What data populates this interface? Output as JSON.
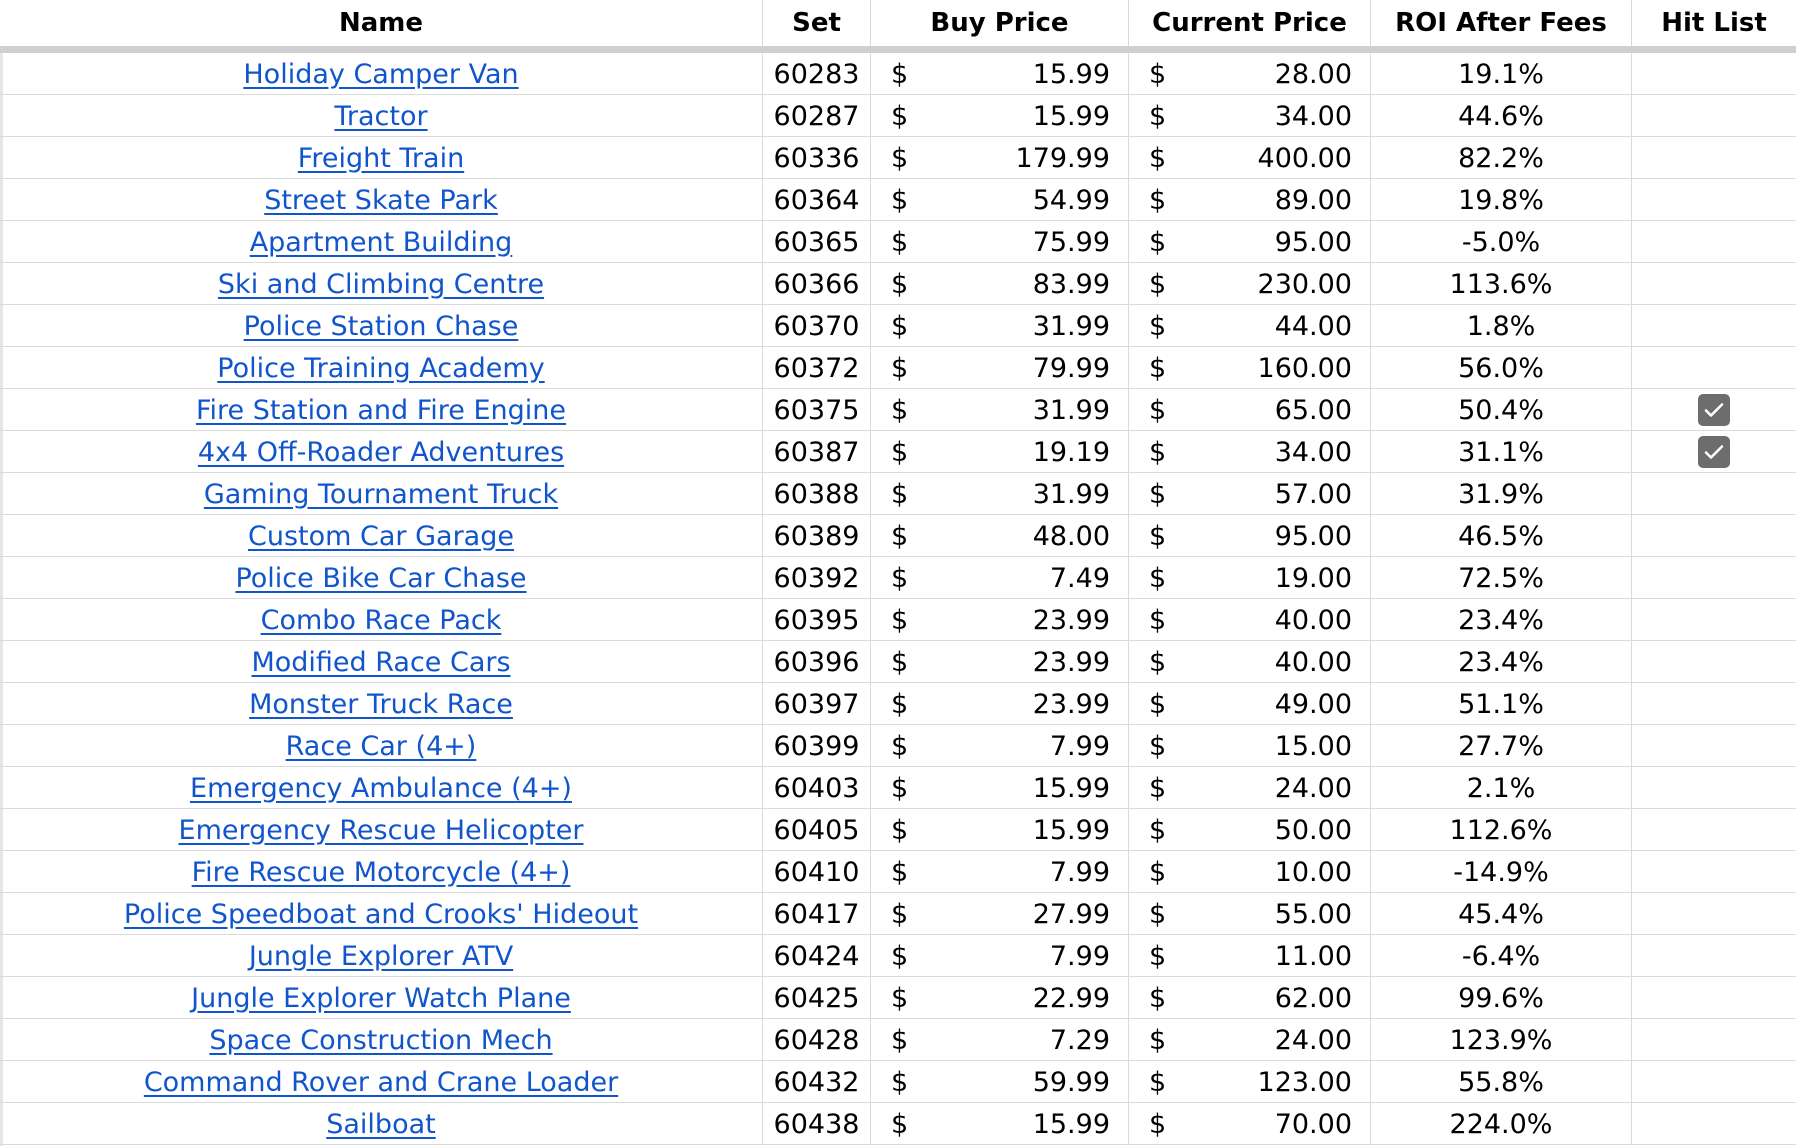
{
  "headers": {
    "name": "Name",
    "set": "Set",
    "buy": "Buy Price",
    "current": "Current Price",
    "roi": "ROI After Fees",
    "hit": "Hit List"
  },
  "currency_symbol": "$",
  "rows": [
    {
      "name": "Holiday Camper Van",
      "set": "60283",
      "buy": "15.99",
      "current": "28.00",
      "roi": "19.1%",
      "hit": false
    },
    {
      "name": "Tractor",
      "set": "60287",
      "buy": "15.99",
      "current": "34.00",
      "roi": "44.6%",
      "hit": false
    },
    {
      "name": "Freight Train",
      "set": "60336",
      "buy": "179.99",
      "current": "400.00",
      "roi": "82.2%",
      "hit": false
    },
    {
      "name": "Street Skate Park",
      "set": "60364",
      "buy": "54.99",
      "current": "89.00",
      "roi": "19.8%",
      "hit": false
    },
    {
      "name": "Apartment Building",
      "set": "60365",
      "buy": "75.99",
      "current": "95.00",
      "roi": "-5.0%",
      "hit": false
    },
    {
      "name": "Ski and Climbing Centre",
      "set": "60366",
      "buy": "83.99",
      "current": "230.00",
      "roi": "113.6%",
      "hit": false
    },
    {
      "name": "Police Station Chase",
      "set": "60370",
      "buy": "31.99",
      "current": "44.00",
      "roi": "1.8%",
      "hit": false
    },
    {
      "name": "Police Training Academy",
      "set": "60372",
      "buy": "79.99",
      "current": "160.00",
      "roi": "56.0%",
      "hit": false
    },
    {
      "name": "Fire Station and Fire Engine",
      "set": "60375",
      "buy": "31.99",
      "current": "65.00",
      "roi": "50.4%",
      "hit": true
    },
    {
      "name": "4x4 Off-Roader Adventures",
      "set": "60387",
      "buy": "19.19",
      "current": "34.00",
      "roi": "31.1%",
      "hit": true
    },
    {
      "name": "Gaming Tournament Truck",
      "set": "60388",
      "buy": "31.99",
      "current": "57.00",
      "roi": "31.9%",
      "hit": false
    },
    {
      "name": "Custom Car Garage",
      "set": "60389",
      "buy": "48.00",
      "current": "95.00",
      "roi": "46.5%",
      "hit": false
    },
    {
      "name": "Police Bike Car Chase",
      "set": "60392",
      "buy": "7.49",
      "current": "19.00",
      "roi": "72.5%",
      "hit": false
    },
    {
      "name": "Combo Race Pack",
      "set": "60395",
      "buy": "23.99",
      "current": "40.00",
      "roi": "23.4%",
      "hit": false
    },
    {
      "name": "Modified Race Cars",
      "set": "60396",
      "buy": "23.99",
      "current": "40.00",
      "roi": "23.4%",
      "hit": false
    },
    {
      "name": "Monster Truck Race",
      "set": "60397",
      "buy": "23.99",
      "current": "49.00",
      "roi": "51.1%",
      "hit": false
    },
    {
      "name": "Race Car (4+)",
      "set": "60399",
      "buy": "7.99",
      "current": "15.00",
      "roi": "27.7%",
      "hit": false
    },
    {
      "name": "Emergency Ambulance (4+)",
      "set": "60403",
      "buy": "15.99",
      "current": "24.00",
      "roi": "2.1%",
      "hit": false
    },
    {
      "name": "Emergency Rescue Helicopter",
      "set": "60405",
      "buy": "15.99",
      "current": "50.00",
      "roi": "112.6%",
      "hit": false
    },
    {
      "name": "Fire Rescue Motorcycle (4+)",
      "set": "60410",
      "buy": "7.99",
      "current": "10.00",
      "roi": "-14.9%",
      "hit": false
    },
    {
      "name": "Police Speedboat and Crooks' Hideout",
      "set": "60417",
      "buy": "27.99",
      "current": "55.00",
      "roi": "45.4%",
      "hit": false
    },
    {
      "name": "Jungle Explorer ATV",
      "set": "60424",
      "buy": "7.99",
      "current": "11.00",
      "roi": "-6.4%",
      "hit": false
    },
    {
      "name": "Jungle Explorer Watch Plane",
      "set": "60425",
      "buy": "22.99",
      "current": "62.00",
      "roi": "99.6%",
      "hit": false
    },
    {
      "name": "Space Construction Mech",
      "set": "60428",
      "buy": "7.29",
      "current": "24.00",
      "roi": "123.9%",
      "hit": false
    },
    {
      "name": "Command Rover and Crane Loader",
      "set": "60432",
      "buy": "59.99",
      "current": "123.00",
      "roi": "55.8%",
      "hit": false
    },
    {
      "name": "Sailboat",
      "set": "60438",
      "buy": "15.99",
      "current": "70.00",
      "roi": "224.0%",
      "hit": false
    }
  ]
}
